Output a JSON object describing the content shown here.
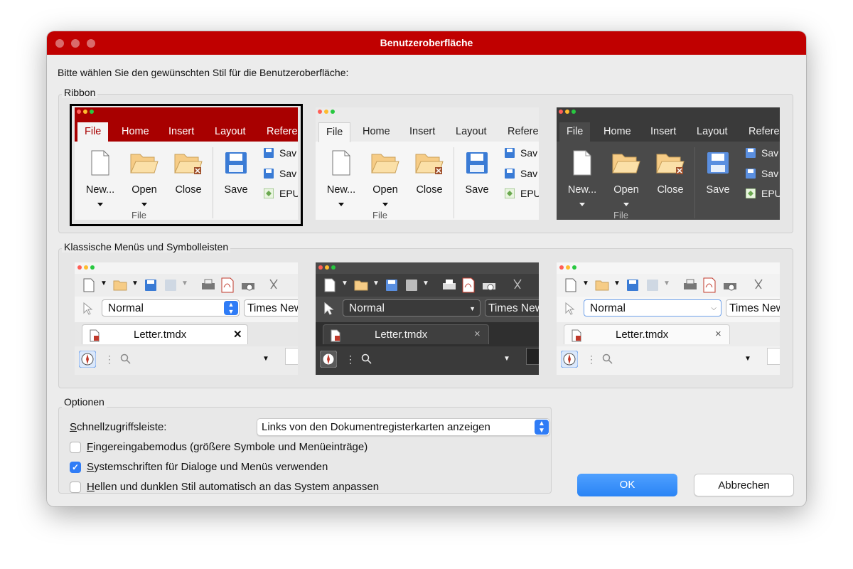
{
  "window": {
    "title": "Benutzeroberfläche",
    "instruction": "Bitte wählen Sie den gewünschten Stil für die Benutzeroberfläche:"
  },
  "ribbon_group": {
    "label": "Ribbon",
    "tabs": [
      "File",
      "Home",
      "Insert",
      "Layout",
      "Refere"
    ],
    "buttons": [
      "New...",
      "Open",
      "Close",
      "Save"
    ],
    "small_buttons": [
      "Sav",
      "Sav",
      "EPU"
    ],
    "group_label": "File",
    "previews": [
      {
        "theme": "red",
        "selected": true
      },
      {
        "theme": "light",
        "selected": false
      },
      {
        "theme": "dark",
        "selected": false
      }
    ]
  },
  "classic_group": {
    "label": "Klassische Menüs und Symbolleisten",
    "style_value": "Normal",
    "font_value": "Times New",
    "document_tab": "Letter.tmdx",
    "close_glyph": "×",
    "close_glyph_bold": "✕",
    "previews": [
      {
        "theme": "light-mac"
      },
      {
        "theme": "dark"
      },
      {
        "theme": "light-flat"
      }
    ]
  },
  "options_group": {
    "label": "Optionen",
    "quick_access_label_u": "S",
    "quick_access_label_rest": "chnellzugriffsleiste:",
    "quick_access_value": "Links von den Dokumentregisterkarten anzeigen",
    "checkboxes": [
      {
        "u": "F",
        "rest": "ingereingabemodus (größere Symbole und Menüeinträge)",
        "checked": false
      },
      {
        "u": "S",
        "rest": "ystemschriften für Dialoge und Menüs verwenden",
        "checked": true
      },
      {
        "u": "H",
        "rest": "ellen und dunklen Stil automatisch an das System anpassen",
        "checked": false
      }
    ],
    "check_glyph": "✓"
  },
  "buttons": {
    "ok": "OK",
    "cancel": "Abbrechen"
  },
  "colors": {
    "title_bar": "#c00000",
    "accent": "#2f7cf6",
    "ribbon_red": "#a80000",
    "dark_bg": "#4a4a4a"
  }
}
